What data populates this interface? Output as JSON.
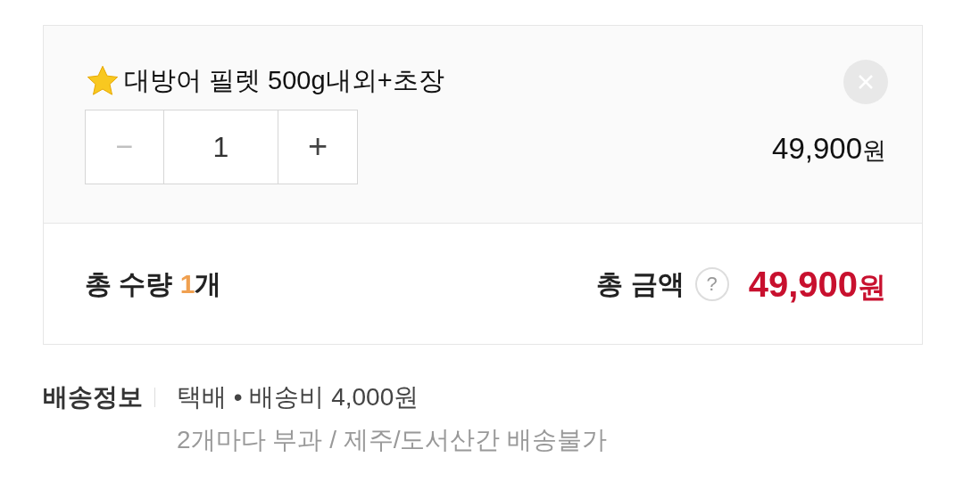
{
  "option": {
    "title": "대방어 필렛 500g내외+초장",
    "quantity": {
      "minus": "−",
      "value": "1",
      "plus": "+"
    },
    "price": {
      "amount": "49,900",
      "unit": "원"
    }
  },
  "summary": {
    "quantity": {
      "label": "총 수량",
      "count": "1",
      "unit": "개"
    },
    "total": {
      "label": "총 금액",
      "help": "?",
      "amount": "49,900",
      "unit": "원"
    }
  },
  "delivery": {
    "label": "배송정보",
    "method": "택배 • 배송비 4,000원",
    "note": "2개마다 부과 / 제주/도서산간 배송불가"
  }
}
